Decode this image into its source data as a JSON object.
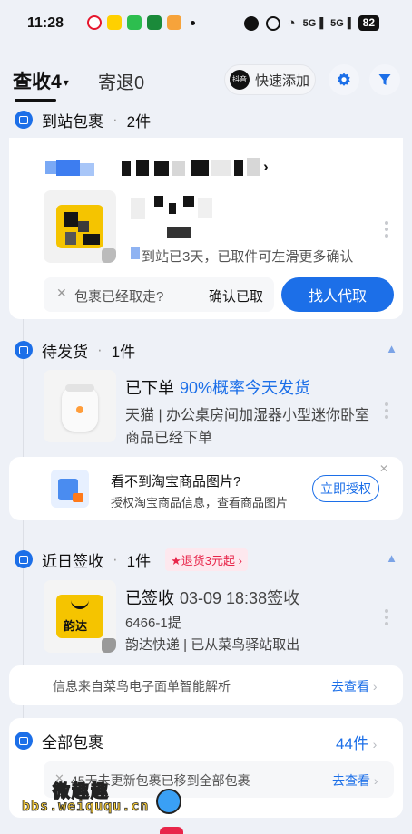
{
  "status_bar": {
    "time": "11:28",
    "battery": "82",
    "network_5g_a": "5G",
    "network_5g_b": "5G"
  },
  "header": {
    "tab_collect": "查收4",
    "tab_send": "寄退0",
    "quick_add_label": "快速添加",
    "quick_add_badge": "抖音"
  },
  "sections": {
    "arrived": {
      "title": "到站包裹",
      "count": "2件"
    },
    "pending_ship": {
      "title": "待发货",
      "count": "1件"
    },
    "recent_signed": {
      "title": "近日签收",
      "count": "1件",
      "badge": "★退货3元起"
    },
    "all_packages": {
      "title": "全部包裹",
      "count": "44件"
    }
  },
  "arrived_card": {
    "status_text": "到站已3天，已取件可左滑更多确认",
    "question": "包裹已经取走?",
    "confirm_label": "确认已取",
    "proxy_label": "找人代取"
  },
  "pending_card": {
    "status": "已下单",
    "probability": "90%概率今天发货",
    "product": "天猫 | 办公桌房间加湿器小型迷你卧室",
    "note": "商品已经下单",
    "auth_title": "看不到淘宝商品图片?",
    "auth_desc": "授权淘宝商品信息，查看商品图片",
    "auth_button": "立即授权"
  },
  "signed_card": {
    "status": "已签收",
    "time": "03-09 18:38签收",
    "pickup_code": "6466-1提",
    "carrier_line": "韵达快递 | 已从菜鸟驿站取出",
    "carrier_logo": "韵达",
    "info_text": "信息来自菜鸟电子面单智能解析",
    "view_label": "去查看"
  },
  "all_card": {
    "info_text": "45天未更新包裹已移到全部包裹",
    "view_label": "去查看"
  },
  "watermark": {
    "text": "微趣趣",
    "url": "bbs.weiququ.cn"
  },
  "colors": {
    "accent": "#1c6fe8",
    "badge_red": "#e8264a",
    "badge_bg": "#fde8ee"
  }
}
